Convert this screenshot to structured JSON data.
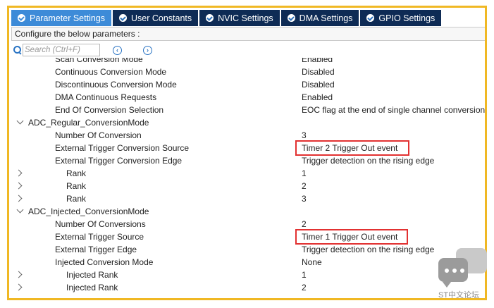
{
  "tabs": [
    {
      "label": "Parameter Settings",
      "active": true
    },
    {
      "label": "User Constants",
      "active": false
    },
    {
      "label": "NVIC Settings",
      "active": false
    },
    {
      "label": "DMA Settings",
      "active": false
    },
    {
      "label": "GPIO Settings",
      "active": false
    }
  ],
  "configure_text": "Configure the below parameters :",
  "search": {
    "placeholder": "Search (Ctrl+F)"
  },
  "rows": [
    {
      "label": "Scan Conversion Mode",
      "value": "Enabled"
    },
    {
      "label": "Continuous Conversion Mode",
      "value": "Disabled"
    },
    {
      "label": "Discontinuous Conversion Mode",
      "value": "Disabled"
    },
    {
      "label": "DMA Continuous Requests",
      "value": "Enabled"
    },
    {
      "label": "End Of Conversion Selection",
      "value": "EOC flag at the end of single channel conversion"
    },
    {
      "label": "ADC_Regular_ConversionMode",
      "value": ""
    },
    {
      "label": "Number Of Conversion",
      "value": "3"
    },
    {
      "label": "External Trigger Conversion Source",
      "value": "Timer 2 Trigger Out event"
    },
    {
      "label": "External Trigger Conversion Edge",
      "value": "Trigger detection on the rising edge"
    },
    {
      "label": "Rank",
      "value": "1"
    },
    {
      "label": "Rank",
      "value": "2"
    },
    {
      "label": "Rank",
      "value": "3"
    },
    {
      "label": "ADC_Injected_ConversionMode",
      "value": ""
    },
    {
      "label": "Number Of Conversions",
      "value": "2"
    },
    {
      "label": "External Trigger Source",
      "value": "Timer 1 Trigger Out event"
    },
    {
      "label": "External Trigger Edge",
      "value": "Trigger detection on the rising edge"
    },
    {
      "label": "Injected Conversion Mode",
      "value": "None"
    },
    {
      "label": "Injected Rank",
      "value": "1"
    },
    {
      "label": "Injected Rank",
      "value": "2"
    }
  ],
  "watermark": "ST中文论坛",
  "colors": {
    "frame": "#f0b824",
    "tab_dark": "#0e2b55",
    "tab_active": "#3d8bd8",
    "highlight": "#e23131"
  }
}
